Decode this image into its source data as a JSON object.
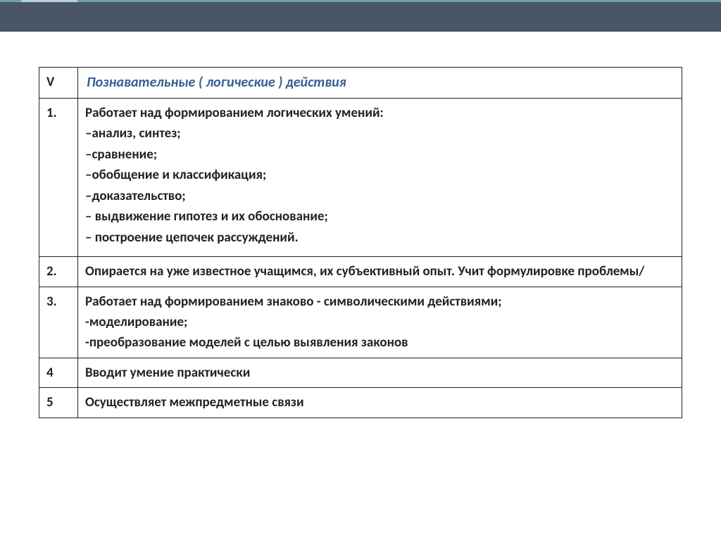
{
  "table": {
    "header": {
      "roman": "V",
      "title": "Познавательные ( логические   ) действия"
    },
    "rows": [
      {
        "num": "1.",
        "lines": [
          "Работает над формированием  логических умений:",
          "–анализ, синтез;",
          "–сравнение;",
          "–обобщение и классификация;",
          "–доказательство;",
          "– выдвижение гипотез и их обоснование;",
          "– построение цепочек рассуждений."
        ]
      },
      {
        "num": "2.",
        "lines": [
          "Опирается на уже известное учащимся, их субъективный опыт. Учит формулировке проблемы/"
        ]
      },
      {
        "num": "3.",
        "lines": [
          "Работает над формированием знаково - символическими действиями;",
          "-моделирование;",
          "-преобразование моделей с целью выявления законов"
        ]
      },
      {
        "num": "4",
        "lines": [
          "Вводит умение практически"
        ]
      },
      {
        "num": "5",
        "lines": [
          "Осуществляет межпредметные связи"
        ]
      }
    ]
  }
}
